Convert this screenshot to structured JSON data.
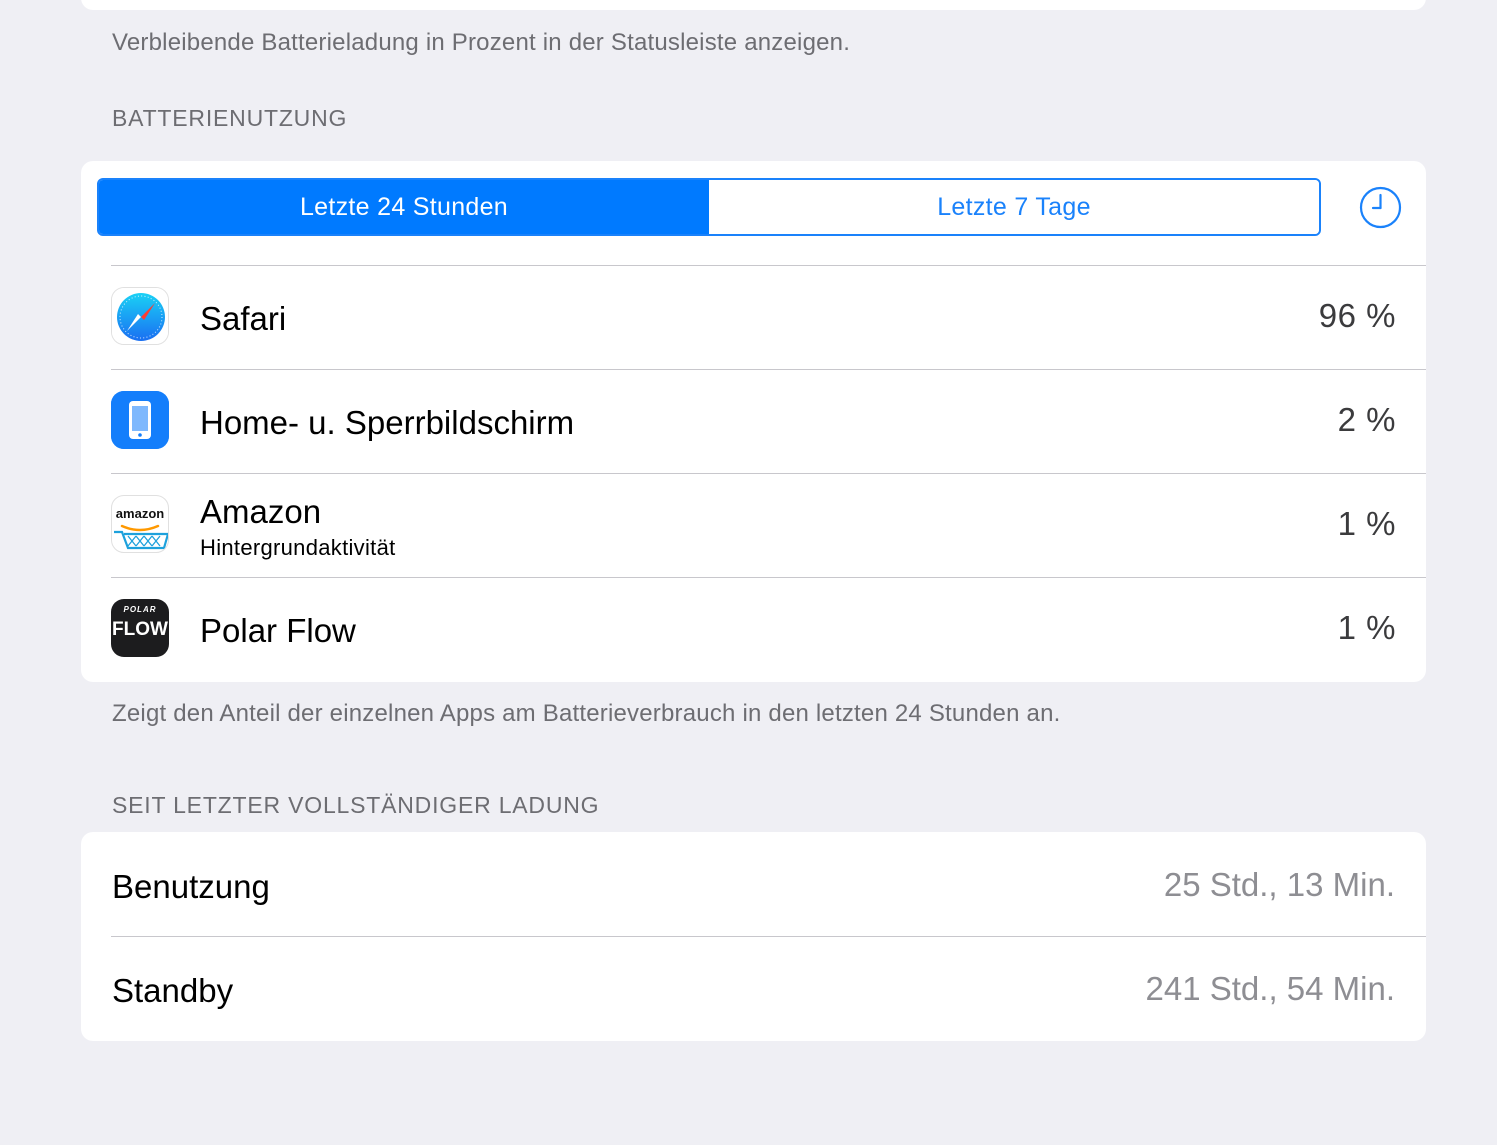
{
  "top": {
    "footnote": "Verbleibende Batterieladung in Prozent in der Statusleiste anzeigen."
  },
  "battery_usage": {
    "header": "BATTERIENUTZUNG",
    "segments": [
      "Letzte 24 Stunden",
      "Letzte 7 Tage"
    ],
    "selected_segment": "Letzte 24 Stunden",
    "clock_icon": "clock-icon",
    "apps": [
      {
        "name": "Safari",
        "subtitle": "",
        "value": "96 %",
        "icon": "safari-icon"
      },
      {
        "name": "Home- u. Sperrbildschirm",
        "subtitle": "",
        "value": "2 %",
        "icon": "home-lockscreen-icon"
      },
      {
        "name": "Amazon",
        "subtitle": "Hintergrundaktivität",
        "value": "1 %",
        "icon": "amazon-icon"
      },
      {
        "name": "Polar Flow",
        "subtitle": "",
        "value": "1 %",
        "icon": "polar-flow-icon"
      }
    ],
    "icon_text": {
      "amazon": "amazon",
      "polar_small": "POLAR",
      "polar_big": "FLOW"
    },
    "footnote": "Zeigt den Anteil der einzelnen Apps am Batterieverbrauch in den letzten 24 Stunden an."
  },
  "since_full_charge": {
    "header": "SEIT LETZTER VOLLSTÄNDIGER LADUNG",
    "rows": [
      {
        "label": "Benutzung",
        "value": "25 Std., 13 Min."
      },
      {
        "label": "Standby",
        "value": "241 Std., 54 Min."
      }
    ]
  },
  "colors": {
    "background": "#efeff4",
    "accent": "#007aff",
    "secondary_text": "#6d6d72",
    "value_gray": "#8e8e93"
  }
}
